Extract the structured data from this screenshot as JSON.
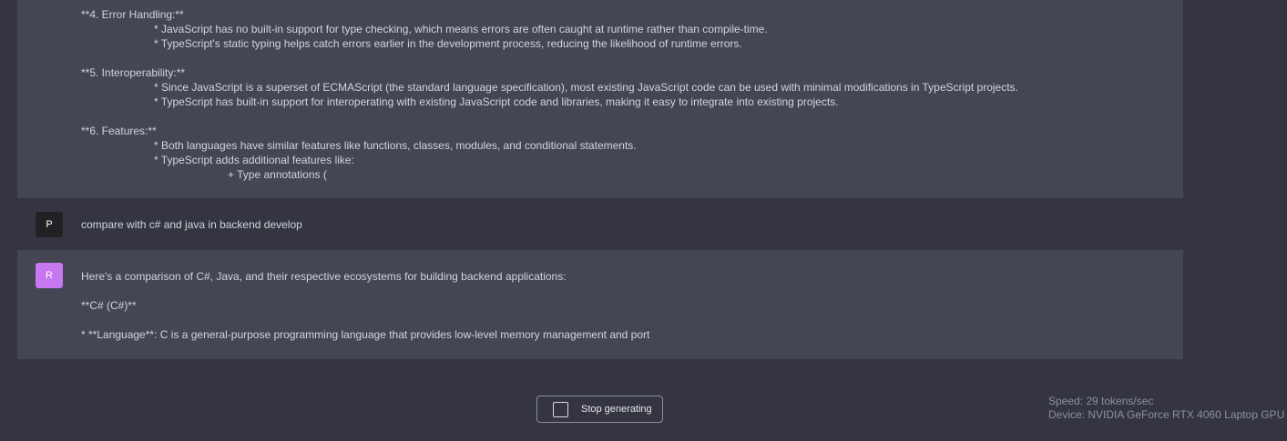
{
  "previous_message": {
    "role": "assistant",
    "lines": [
      "**4. Error Handling:**",
      "* JavaScript has no built-in support for type checking, which means errors are often caught at runtime rather than compile-time.",
      "* TypeScript's static typing helps catch errors earlier in the development process, reducing the likelihood of runtime errors.",
      "**5. Interoperability:**",
      "* Since JavaScript is a superset of ECMAScript (the standard language specification), most existing JavaScript code can be used with minimal modifications in TypeScript projects.",
      "* TypeScript has built-in support for interoperating with existing JavaScript code and libraries, making it easy to integrate into existing projects.",
      "**6. Features:**",
      "* Both languages have similar features like functions, classes, modules, and conditional statements.",
      "* TypeScript adds additional features like:",
      "+ Type annotations ("
    ]
  },
  "user_message": {
    "avatar": "P",
    "text": "compare with c# and java in backend develop"
  },
  "assistant_message": {
    "avatar": "R",
    "avatar_color": "#c777f0",
    "lines": [
      "Here's a comparison of C#, Java, and their respective ecosystems for building backend applications:",
      "**C# (C#)**",
      "* **Language**: C is a general-purpose programming language that provides low-level memory management and port"
    ]
  },
  "controls": {
    "stop_label": "Stop generating",
    "stop_icon": "stop-square-icon"
  },
  "stats": {
    "speed": "Speed: 29 tokens/sec",
    "device": "Device: NVIDIA GeForce RTX 4060 Laptop GPU"
  },
  "colors": {
    "background": "#343541",
    "assistant_bg": "#444654",
    "text": "#d1d5db",
    "muted": "#8e8ea0"
  }
}
